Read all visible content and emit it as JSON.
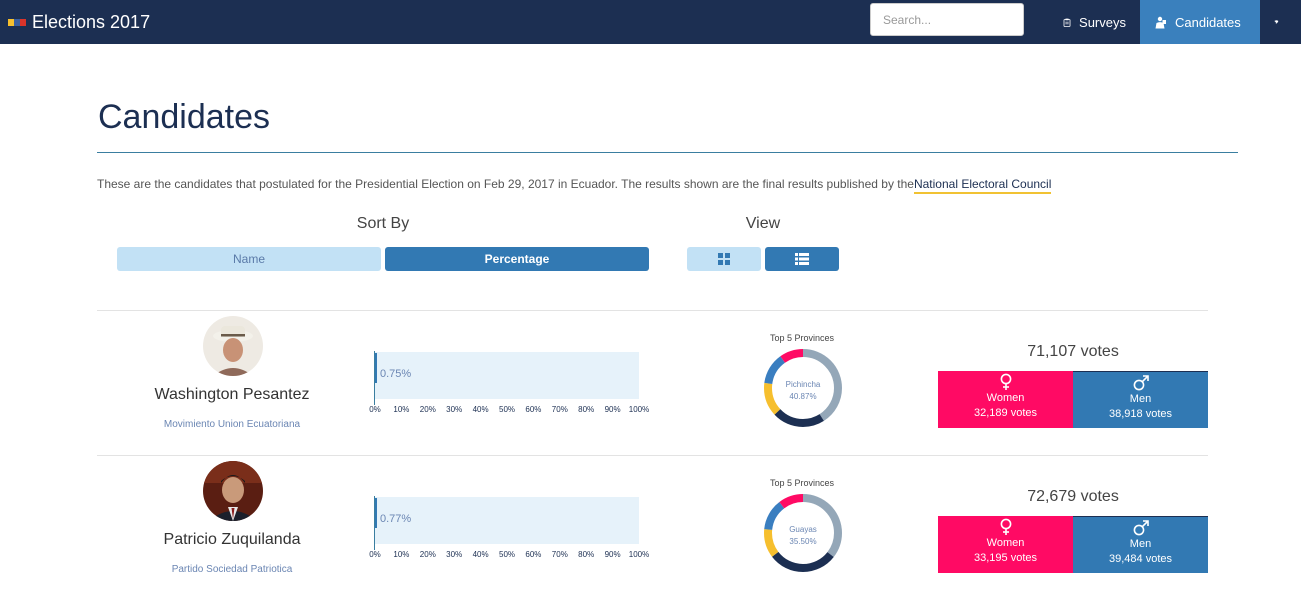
{
  "header": {
    "app_title": "Elections 2017",
    "search_placeholder": "Search...",
    "nav": {
      "surveys": "Surveys",
      "candidates": "Candidates"
    }
  },
  "page": {
    "title": "Candidates",
    "intro_text": "These are the candidates that postulated for the Presidential Election on Feb 29, 2017 in Ecuador. The results shown are the final results published by the",
    "intro_link": "National Electoral Council"
  },
  "controls": {
    "sort_label": "Sort By",
    "sort_name": "Name",
    "sort_percentage": "Percentage",
    "view_label": "View",
    "icons": {
      "grid": "grid-icon",
      "list": "list-icon"
    }
  },
  "axis_ticks": [
    "0%",
    "10%",
    "20%",
    "30%",
    "40%",
    "50%",
    "60%",
    "70%",
    "80%",
    "90%",
    "100%"
  ],
  "candidates": [
    {
      "name": "Washington Pesantez",
      "party": "Movimiento Union Ecuatoriana",
      "percentage_label": "0.75%",
      "percentage": 0.75,
      "donut_title": "Top 5 Provinces",
      "top_province": "Pichincha",
      "top_province_pct": "40.87%",
      "donut_shares": [
        40.87,
        22,
        14,
        13,
        10
      ],
      "total_votes": "71,107 votes",
      "women_label": "Women",
      "women_votes": "32,189 votes",
      "men_label": "Men",
      "men_votes": "38,918 votes"
    },
    {
      "name": "Patricio Zuquilanda",
      "party": "Partido Sociedad Patriotica",
      "percentage_label": "0.77%",
      "percentage": 0.77,
      "donut_title": "Top 5 Provinces",
      "top_province": "Guayas",
      "top_province_pct": "35.50%",
      "donut_shares": [
        35.5,
        29,
        12,
        13,
        10.5
      ],
      "total_votes": "72,679 votes",
      "women_label": "Women",
      "women_votes": "33,195 votes",
      "men_label": "Men",
      "men_votes": "39,484 votes"
    }
  ],
  "colors": {
    "navbar": "#1c2f52",
    "accent": "#3279b3",
    "women": "#ff0a64",
    "donut": [
      "#94a7b8",
      "#1c2f52",
      "#f6bf2e",
      "#3a7ec0",
      "#ff0a64"
    ]
  }
}
